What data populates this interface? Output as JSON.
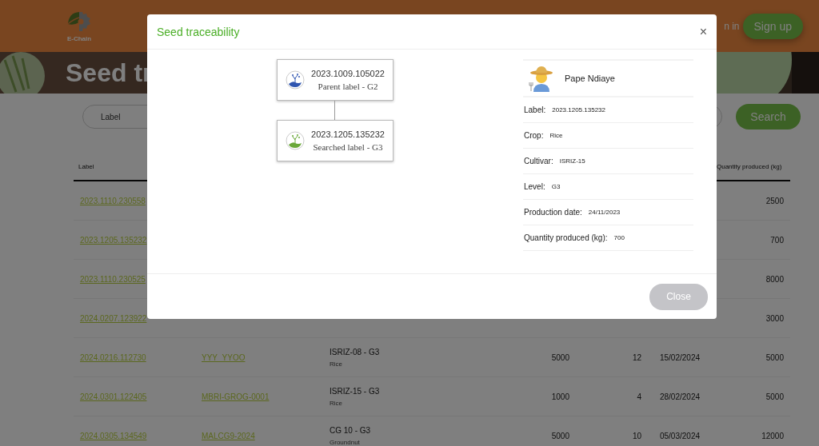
{
  "header": {
    "logo_text": "E-Chain",
    "sign_in": "n in",
    "sign_up": "Sign up"
  },
  "hero": {
    "title": "Seed tr"
  },
  "search": {
    "placeholder": "Label",
    "button": "Search"
  },
  "table": {
    "columns": [
      "Label",
      "Quantity produced (kg)"
    ],
    "rows": [
      {
        "label": "2023.1110.230558",
        "quantity_produced": "2500"
      },
      {
        "label": "2023.1205.135232",
        "quantity_produced": "700"
      },
      {
        "label": "2023.1110.230525",
        "quantity_produced": "8000"
      },
      {
        "label": "2024.0207.123922",
        "quantity_produced": "3000"
      },
      {
        "label": "2024.0216.112730",
        "column_2": "YYY_YYOO",
        "column_3": {
          "title": "ISRIZ-08 - G3",
          "subtitle": "Rice"
        },
        "column_4": "5000",
        "column_5": "12",
        "column_6": "15/02/2024",
        "quantity_produced": "5000"
      },
      {
        "label": "2024.0301.122405",
        "column_2": "MBRI-GROG-0001",
        "column_3": {
          "title": "ISRIZ-15 - G3",
          "subtitle": "Rice"
        },
        "column_4": "1000",
        "column_5": "4",
        "column_6": "28/02/2024",
        "quantity_produced": "5000"
      },
      {
        "label": "2024.0305.134549",
        "column_2": "MALCG9-2024",
        "column_3": {
          "title": "CG 10 - G3",
          "subtitle": "Groundnut"
        },
        "column_4": "5000",
        "column_5": "10",
        "column_6": "05/03/2024",
        "quantity_produced": "12000"
      }
    ]
  },
  "modal": {
    "title": "Seed traceability",
    "close_icon": "×",
    "tree": {
      "label": "2023.1009.105022",
      "caption": "Parent label - G2",
      "color": "#2f55b0",
      "children": [
        {
          "label": "2023.1205.135232",
          "caption": "Searched label - G3",
          "color": "#6aa83a"
        }
      ]
    },
    "producer": {
      "name": "Pape Ndiaye",
      "fields": [
        {
          "label": "Label:",
          "value": "2023.1205.135232"
        },
        {
          "label": "Crop:",
          "value": "Rice"
        },
        {
          "label": "Cultivar:",
          "value": "ISRIZ-15"
        },
        {
          "label": "Level:",
          "value": "G3"
        },
        {
          "label": "Production date:",
          "value": "24/11/2023"
        },
        {
          "label": "Quantity produced (kg):",
          "value": "700"
        }
      ]
    },
    "close_button": "Close"
  }
}
